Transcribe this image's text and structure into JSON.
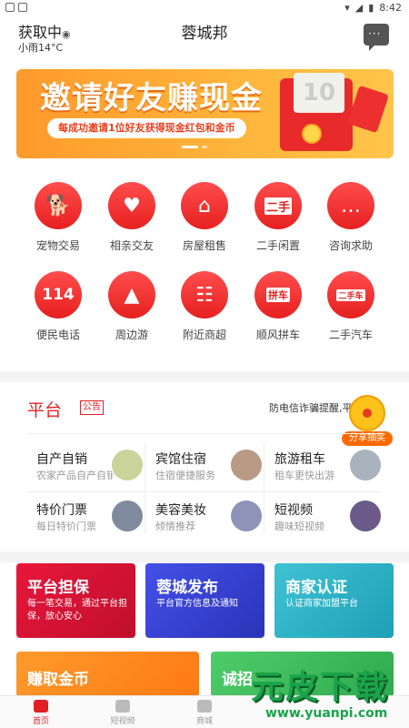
{
  "status_bar": {
    "time": "8:42"
  },
  "header": {
    "location": "获取中",
    "weather": "小雨14°C",
    "title": "蓉城邦"
  },
  "banner": {
    "headline": "邀请好友赚现金",
    "subline": "每成功邀请1位好友获得现金红包和金币",
    "card_number": "10"
  },
  "categories": [
    {
      "label": "宠物交易",
      "icon": "dog-icon"
    },
    {
      "label": "相亲交友",
      "icon": "heart-hands-icon"
    },
    {
      "label": "房屋租售",
      "icon": "house-key-icon"
    },
    {
      "label": "二手闲置",
      "icon": "secondhand-tag-icon",
      "badge": "二手"
    },
    {
      "label": "咨询求助",
      "icon": "chat-bubble-icon"
    },
    {
      "label": "便民电话",
      "icon": "phone-114-icon",
      "badge": "114"
    },
    {
      "label": "周边游",
      "icon": "mountain-icon"
    },
    {
      "label": "附近商超",
      "icon": "basket-icon"
    },
    {
      "label": "顺风拼车",
      "icon": "carpool-icon",
      "badge": "拼车"
    },
    {
      "label": "二手汽车",
      "icon": "used-car-icon",
      "badge": "二手车"
    }
  ],
  "platform": {
    "title": "平台",
    "badge": "公告",
    "notice": "防电信诈骗提醒,平",
    "lottery_label": "分享抽奖",
    "services": [
      {
        "title": "自产自销",
        "subtitle": "农家产品自产自销"
      },
      {
        "title": "宾馆住宿",
        "subtitle": "住宿便捷服务"
      },
      {
        "title": "旅游租车",
        "subtitle": "租车更快出游"
      },
      {
        "title": "特价门票",
        "subtitle": "每日特价门票"
      },
      {
        "title": "美容美妆",
        "subtitle": "倾情推荐"
      },
      {
        "title": "短视频",
        "subtitle": "趣味短视频"
      }
    ]
  },
  "promos": [
    {
      "title": "平台担保",
      "subtitle": "每一笔交易，通过平台担保，放心安心",
      "color": "#e8173a"
    },
    {
      "title": "蓉城发布",
      "subtitle": "平台官方信息及通知",
      "color": "#3c48d9"
    },
    {
      "title": "商家认证",
      "subtitle": "认证商家加盟平台",
      "color": "#2fb4c9"
    }
  ],
  "tiles": [
    {
      "title": "赚取金币",
      "color": "#ff8a1a"
    },
    {
      "title": "诚招",
      "color": "#3dbf5a"
    }
  ],
  "tabbar": [
    {
      "label": "首页",
      "active": true
    },
    {
      "label": "短视频",
      "active": false
    },
    {
      "label": "商城",
      "active": false
    }
  ],
  "watermark": {
    "logo": "元皮下载",
    "url": "www.yuanpi.com"
  }
}
